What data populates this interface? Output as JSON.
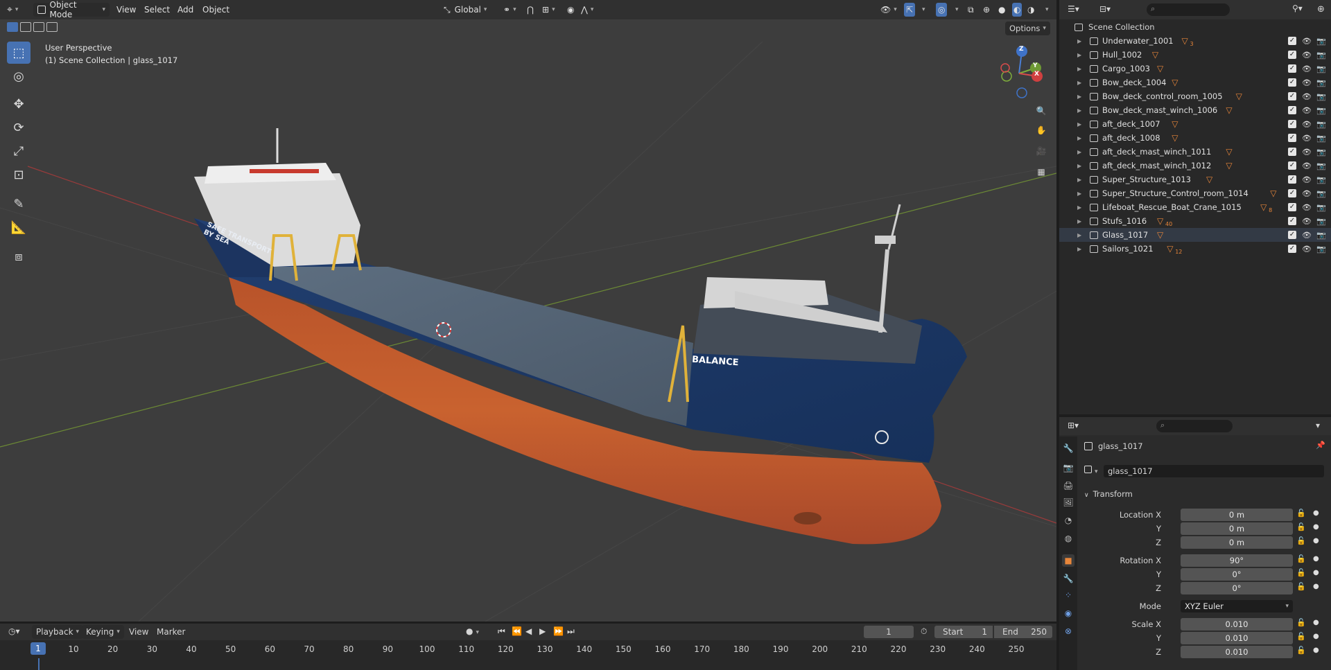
{
  "header": {
    "mode": "Object Mode",
    "menu": [
      "View",
      "Select",
      "Add",
      "Object"
    ],
    "transform_orientation": "Global",
    "options_label": "Options"
  },
  "viewport": {
    "perspective_label": "User Perspective",
    "collection_label": "(1) Scene Collection | glass_1017",
    "ship_name": "BALANCE",
    "hull_text": "SAFE TRANSPORT BY SEA",
    "gizmo_axes": [
      "Z",
      "Y",
      "X"
    ]
  },
  "outliner": {
    "root": "Scene Collection",
    "items": [
      {
        "name": "Underwater_1001",
        "sub": "3"
      },
      {
        "name": "Hull_1002",
        "sub": ""
      },
      {
        "name": "Cargo_1003",
        "sub": ""
      },
      {
        "name": "Bow_deck_1004",
        "sub": ""
      },
      {
        "name": "Bow_deck_control_room_1005",
        "sub": ""
      },
      {
        "name": "Bow_deck_mast_winch_1006",
        "sub": ""
      },
      {
        "name": "aft_deck_1007",
        "sub": ""
      },
      {
        "name": "aft_deck_1008",
        "sub": ""
      },
      {
        "name": "aft_deck_mast_winch_1011",
        "sub": ""
      },
      {
        "name": "aft_deck_mast_winch_1012",
        "sub": ""
      },
      {
        "name": "Super_Structure_1013",
        "sub": ""
      },
      {
        "name": "Super_Structure_Control_room_1014",
        "sub": ""
      },
      {
        "name": "Lifeboat_Rescue_Boat_Crane_1015",
        "sub": "8"
      },
      {
        "name": "Stufs_1016",
        "sub": "40"
      },
      {
        "name": "Glass_1017",
        "sub": ""
      },
      {
        "name": "Sailors_1021",
        "sub": "12"
      }
    ]
  },
  "properties": {
    "object_name": "glass_1017",
    "data_name": "glass_1017",
    "panel": "Transform",
    "location_label": "Location X",
    "location": {
      "x": "0 m",
      "y": "0 m",
      "z": "0 m"
    },
    "rotation_label": "Rotation X",
    "rotation": {
      "x": "90°",
      "y": "0°",
      "z": "0°"
    },
    "mode_label": "Mode",
    "mode": "XYZ Euler",
    "scale_label": "Scale X",
    "scale": {
      "x": "0.010",
      "y": "0.010",
      "z": "0.010"
    },
    "y_label": "Y",
    "z_label": "Z"
  },
  "timeline": {
    "menu": [
      "Playback",
      "Keying",
      "View",
      "Marker"
    ],
    "current_frame": "1",
    "start_label": "Start",
    "start": "1",
    "end_label": "End",
    "end": "250",
    "ruler": [
      "1",
      "10",
      "20",
      "30",
      "40",
      "50",
      "60",
      "70",
      "80",
      "90",
      "100",
      "110",
      "120",
      "130",
      "140",
      "150",
      "160",
      "170",
      "180",
      "190",
      "200",
      "210",
      "220",
      "230",
      "240",
      "250"
    ]
  },
  "colors": {
    "accent": "#4772b3",
    "object_orange": "#e8863a",
    "hull_blue": "#1f3b6b",
    "hull_rust": "#c35a2e"
  }
}
